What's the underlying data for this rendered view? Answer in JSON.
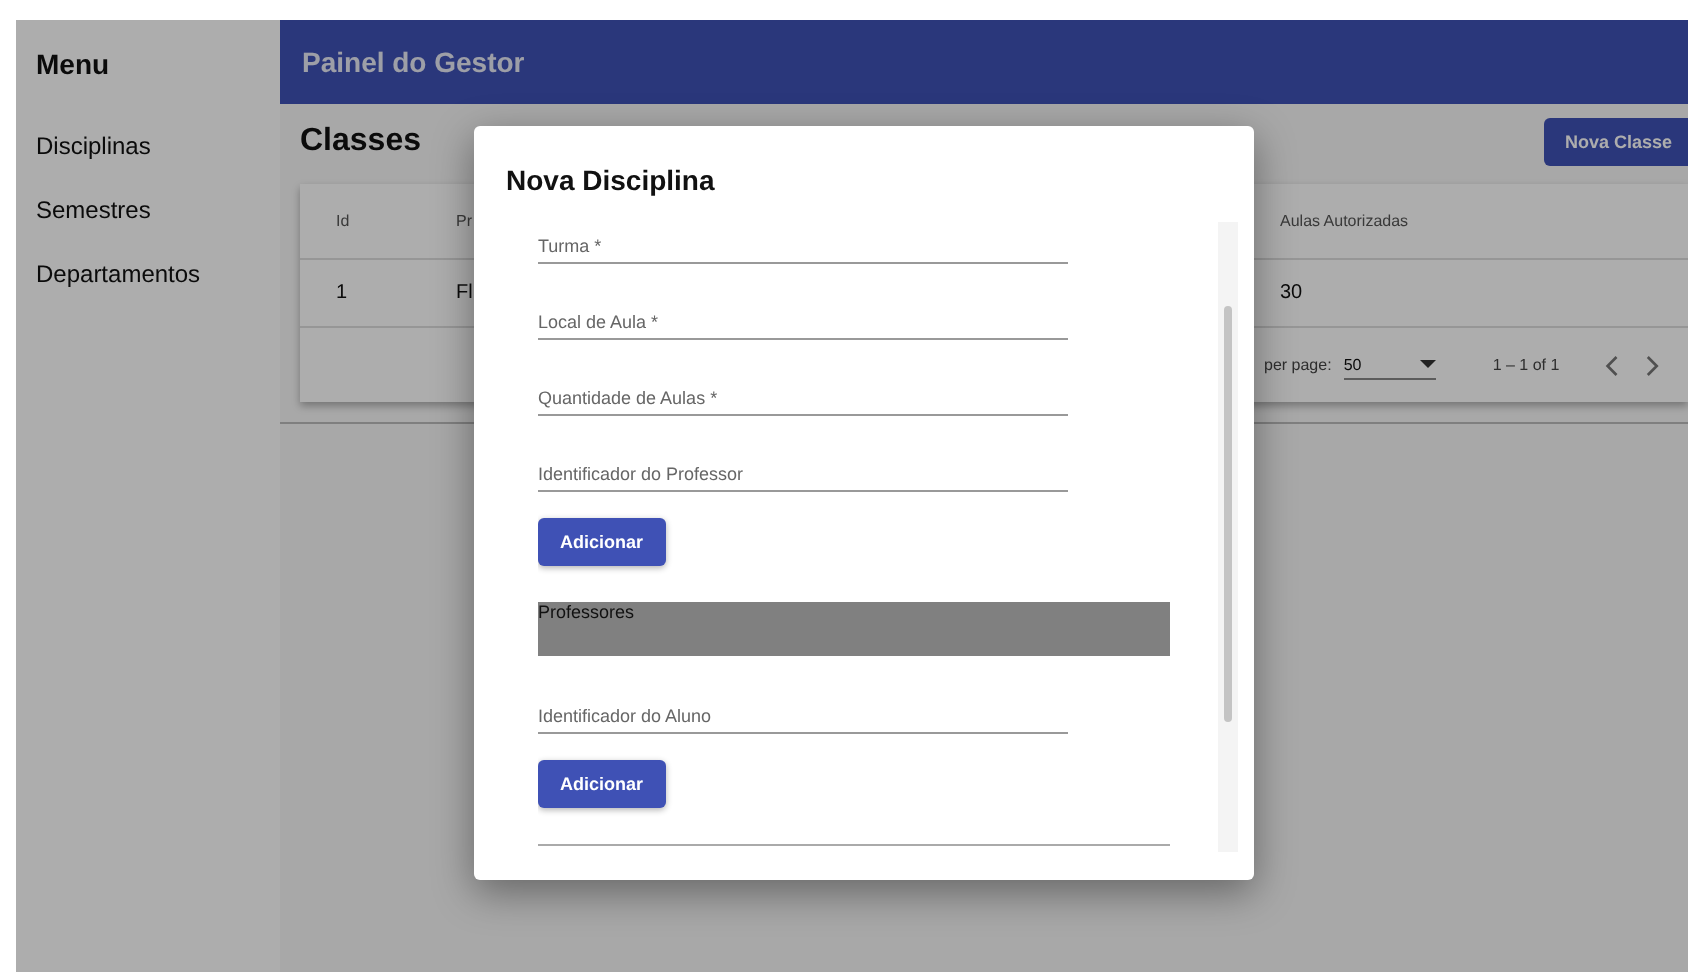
{
  "sidebar": {
    "title": "Menu",
    "items": [
      {
        "label": "Disciplinas"
      },
      {
        "label": "Semestres"
      },
      {
        "label": "Departamentos"
      }
    ]
  },
  "header": {
    "title": "Painel do Gestor"
  },
  "page": {
    "title": "Classes",
    "action": "Nova Classe"
  },
  "table": {
    "columns": [
      "Id",
      "Pr",
      "Aulas Autorizadas"
    ],
    "rows": [
      [
        "1",
        "Fl",
        "30"
      ]
    ],
    "pagination": {
      "rows_per_page_label": "per page:",
      "rows_per_page": "50",
      "range": "1 – 1 of 1"
    }
  },
  "dialog": {
    "title": "Nova Disciplina",
    "items": [
      {
        "kind": "field",
        "placeholder": "Turma *"
      },
      {
        "kind": "field",
        "placeholder": "Local de Aula *"
      },
      {
        "kind": "field",
        "placeholder": "Quantidade de Aulas *"
      },
      {
        "kind": "field",
        "placeholder": "Identificador do Professor"
      },
      {
        "kind": "button",
        "label": "Adicionar"
      },
      {
        "kind": "list",
        "label": "Professores"
      },
      {
        "kind": "field",
        "placeholder": "Identificador do Aluno"
      },
      {
        "kind": "button",
        "label": "Adicionar"
      },
      {
        "kind": "divider"
      }
    ]
  }
}
